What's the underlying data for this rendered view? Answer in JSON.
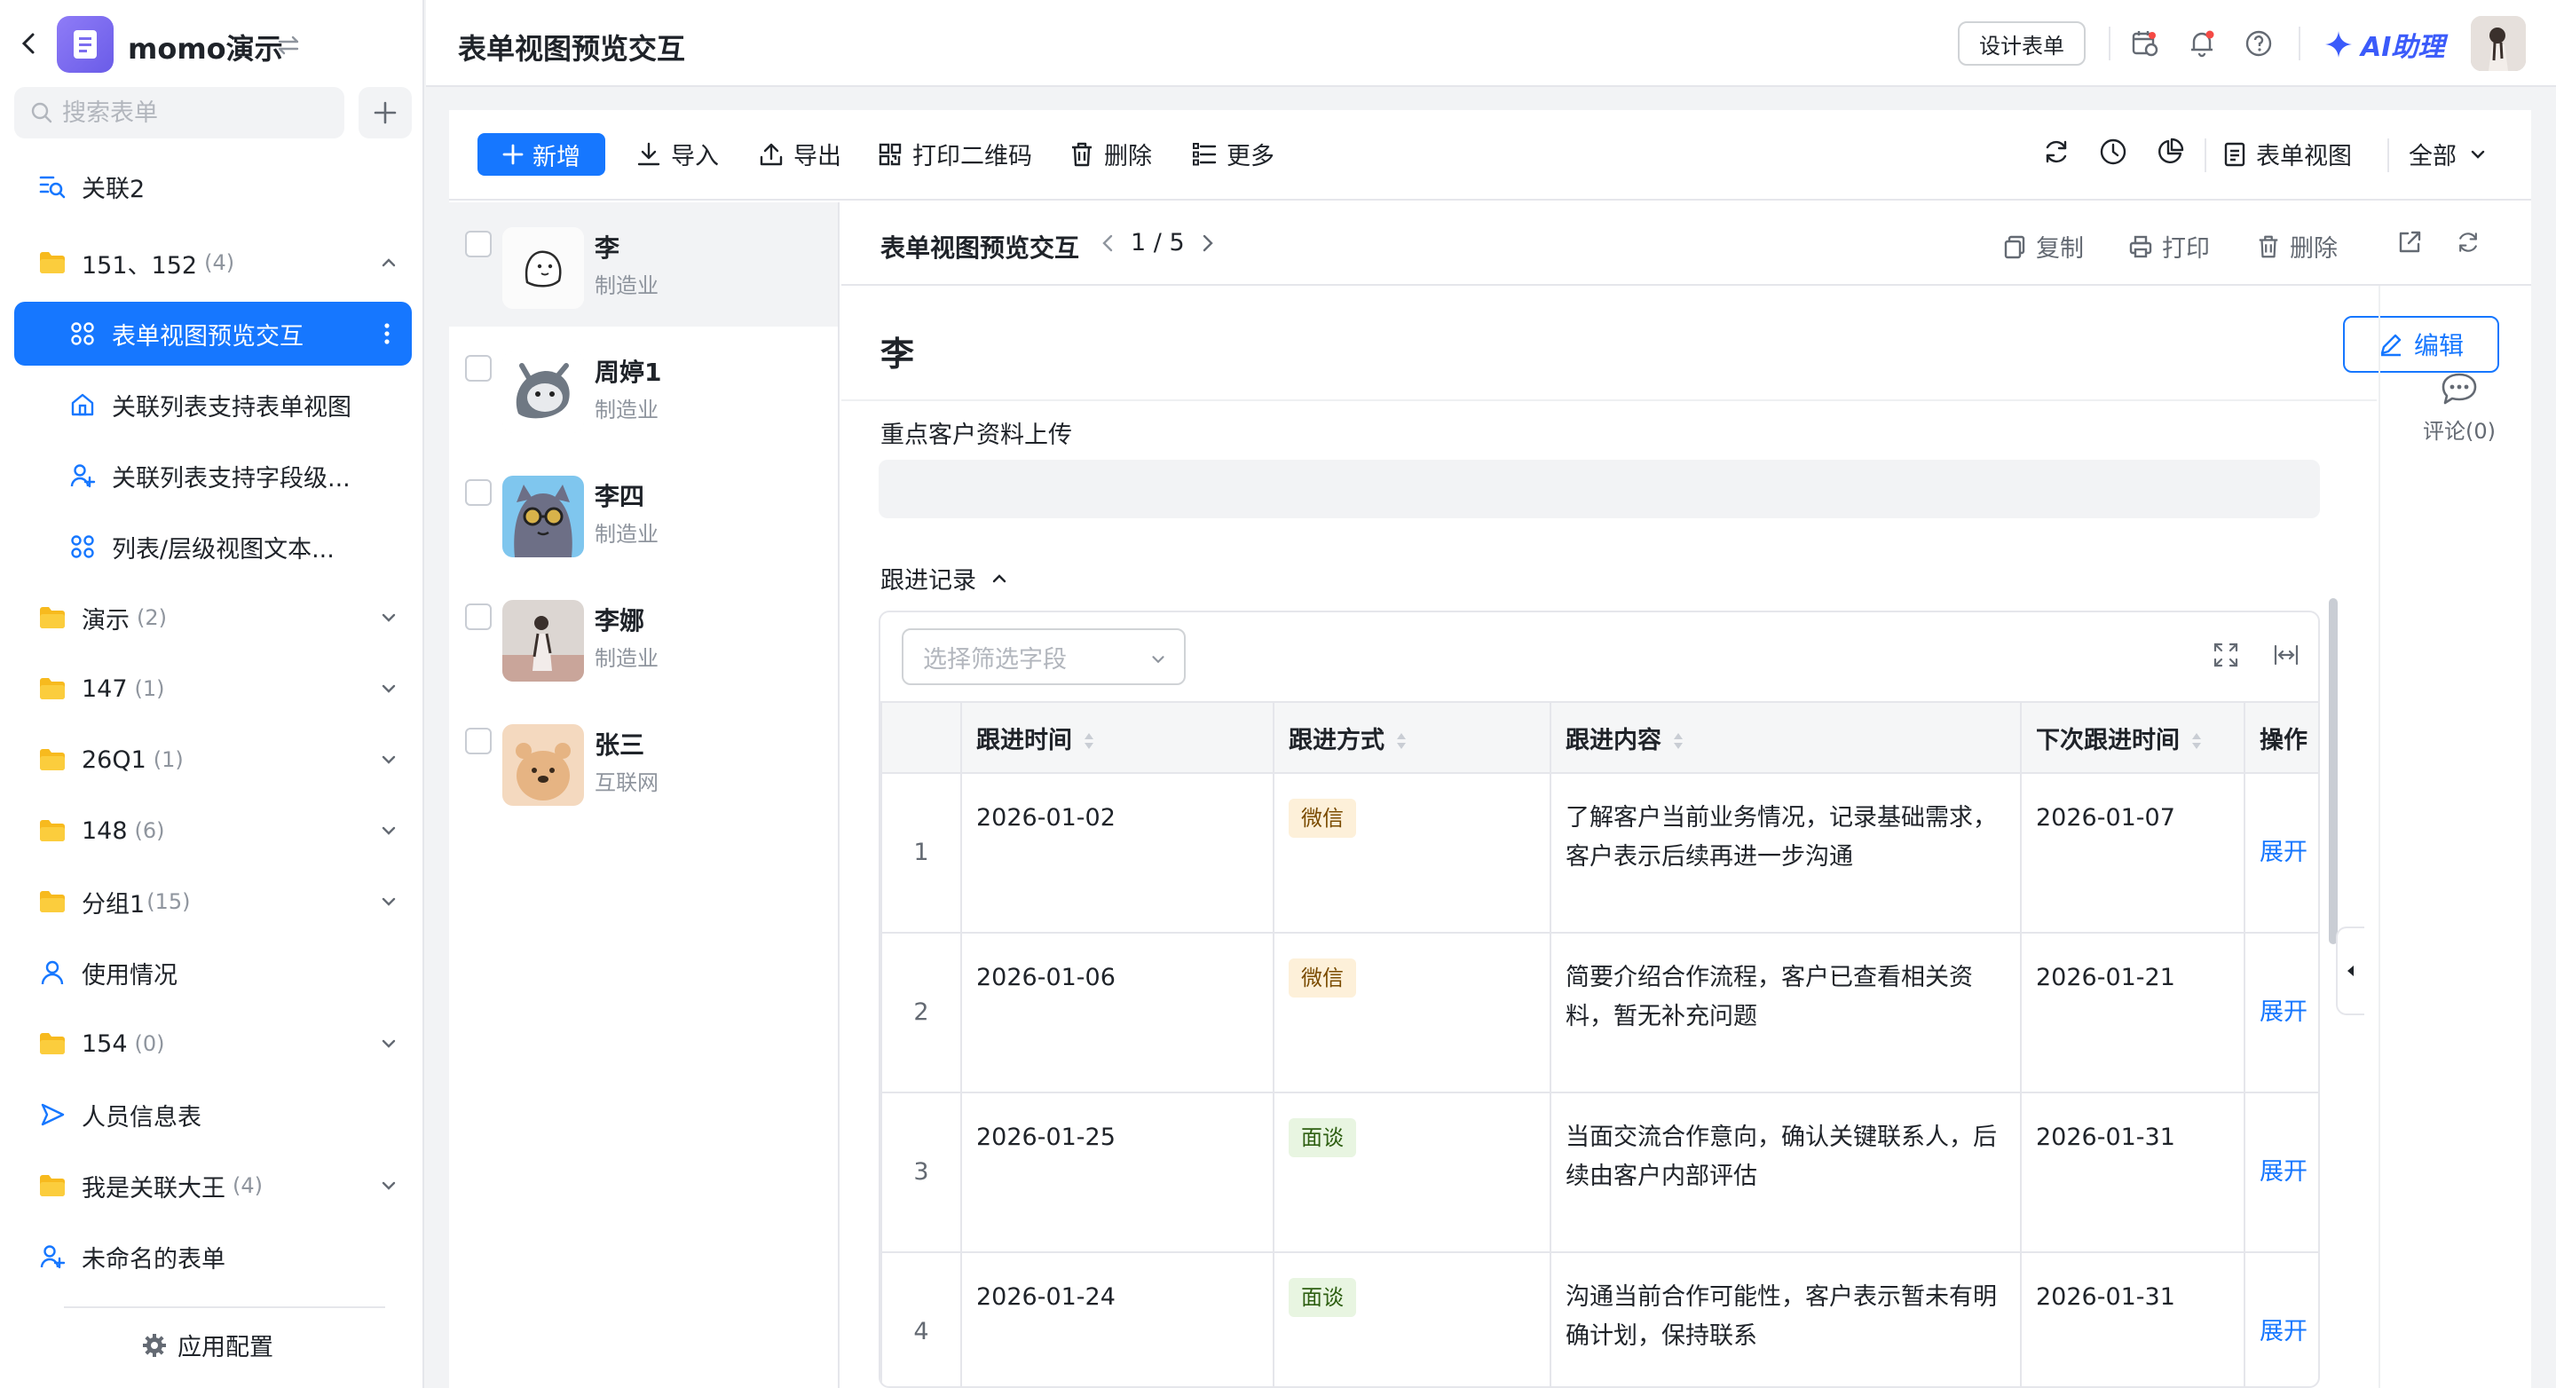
{
  "sidebar": {
    "app_name": "momo演示",
    "search_placeholder": "搜索表单",
    "items": [
      {
        "label": "关联2",
        "count": "",
        "icon": "search-list-icon"
      },
      {
        "label": "151、152",
        "count": "(4)",
        "icon": "folder-icon",
        "expanded": true
      },
      {
        "label": "表单视图预览交互",
        "count": "",
        "icon": "grid-icon",
        "active": true
      },
      {
        "label": "关联列表支持表单视图",
        "count": "",
        "icon": "home-icon"
      },
      {
        "label": "关联列表支持字段级...",
        "count": "",
        "icon": "user-add-icon"
      },
      {
        "label": "列表/层级视图文本...",
        "count": "",
        "icon": "grid-icon"
      },
      {
        "label": "演示",
        "count": "(2)",
        "icon": "folder-icon"
      },
      {
        "label": "147",
        "count": "(1)",
        "icon": "folder-icon"
      },
      {
        "label": "26Q1",
        "count": "(1)",
        "icon": "folder-icon"
      },
      {
        "label": "148",
        "count": "(6)",
        "icon": "folder-icon"
      },
      {
        "label": "分组1",
        "count": "(15)",
        "icon": "folder-icon"
      },
      {
        "label": "使用情况",
        "count": "",
        "icon": "user-icon"
      },
      {
        "label": "154",
        "count": "(0)",
        "icon": "folder-icon"
      },
      {
        "label": "人员信息表",
        "count": "",
        "icon": "send-icon"
      },
      {
        "label": "我是关联大王",
        "count": "(4)",
        "icon": "folder-icon"
      },
      {
        "label": "未命名的表单",
        "count": "",
        "icon": "user-add-icon"
      }
    ],
    "app_config": "应用配置"
  },
  "topbar": {
    "title": "表单视图预览交互",
    "design_form": "设计表单",
    "ai_assistant": "AI助理"
  },
  "toolbar": {
    "new": "新增",
    "import": "导入",
    "export": "导出",
    "print_qr": "打印二维码",
    "delete": "删除",
    "more": "更多",
    "view_name": "表单视图",
    "filter_all": "全部"
  },
  "records": [
    {
      "name": "李",
      "industry": "制造业"
    },
    {
      "name": "周婷1",
      "industry": "制造业"
    },
    {
      "name": "李四",
      "industry": "制造业"
    },
    {
      "name": "李娜",
      "industry": "制造业"
    },
    {
      "name": "张三",
      "industry": "互联网"
    }
  ],
  "detail": {
    "form_title": "表单视图预览交互",
    "pager": "1 / 5",
    "copy": "复制",
    "print": "打印",
    "delete": "删除",
    "record_name": "李",
    "edit": "编辑",
    "upload_field_label": "重点客户资料上传",
    "section_label": "跟进记录",
    "filter_placeholder": "选择筛选字段",
    "comments": "评论(0)",
    "table": {
      "columns": [
        "跟进时间",
        "跟进方式",
        "跟进内容",
        "下次跟进时间",
        "操作"
      ],
      "rows": [
        {
          "idx": "1",
          "time": "2026-01-02",
          "method": "微信",
          "content": "了解客户当前业务情况，记录基础需求，客户表示后续再进一步沟通",
          "next": "2026-01-07",
          "op": "展开"
        },
        {
          "idx": "2",
          "time": "2026-01-06",
          "method": "微信",
          "content": "简要介绍合作流程，客户已查看相关资料，暂无补充问题",
          "next": "2026-01-21",
          "op": "展开"
        },
        {
          "idx": "3",
          "time": "2026-01-25",
          "method": "面谈",
          "content": "当面交流合作意向，确认关键联系人，后续由客户内部评估",
          "next": "2026-01-31",
          "op": "展开"
        },
        {
          "idx": "4",
          "time": "2026-01-24",
          "method": "面谈",
          "content": "沟通当前合作可能性，客户表示暂未有明确计划，保持联系",
          "next": "2026-01-31",
          "op": "展开"
        }
      ]
    }
  },
  "colors": {
    "primary": "#1677ff",
    "ai": "#3b5bfa",
    "folder": "#f7ba1e"
  }
}
